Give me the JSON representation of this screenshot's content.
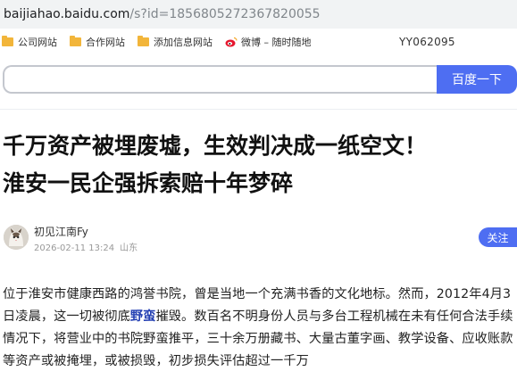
{
  "browser": {
    "url_host": "baijiahao.baidu.com",
    "url_path": "/s?id=1856805272367820055"
  },
  "bookmarks": {
    "items": [
      {
        "label": "公司网站",
        "icon": "folder-icon"
      },
      {
        "label": "合作网站",
        "icon": "folder-icon"
      },
      {
        "label": "添加信息网站",
        "icon": "folder-icon"
      },
      {
        "label": "微博 – 随时随地",
        "icon": "weibo-icon"
      }
    ],
    "code": "YY062095"
  },
  "search": {
    "placeholder": "",
    "button_label": "百度一下"
  },
  "article": {
    "title_line1": "千万资产被埋废墟，生效判决成一纸空文！",
    "title_line2": "淮安一民企强拆索赔十年梦碎",
    "author": "初见江南Fy",
    "date": "2026-02-11 13:24",
    "location": "山东",
    "follow_label": "关注",
    "para_before": "位于淮安市健康西路的鸿誉书院，曾是当地一个充满书香的文化地标。然而，2012年4月3日凌晨，这一切被彻底",
    "para_link": "野蛮",
    "para_after": "摧毁。数百名不明身份人员与多台工程机械在未有任何合法手续情况下，将营业中的书院野蛮推平，三十余万册藏书、大量古董字画、教学设备、应收账款等资产或被掩埋，或被损毁，初步损失评估超过一千万"
  },
  "colors": {
    "accent": "#4e6ef2",
    "link": "#2440b3",
    "folder": "#f2b53a"
  }
}
